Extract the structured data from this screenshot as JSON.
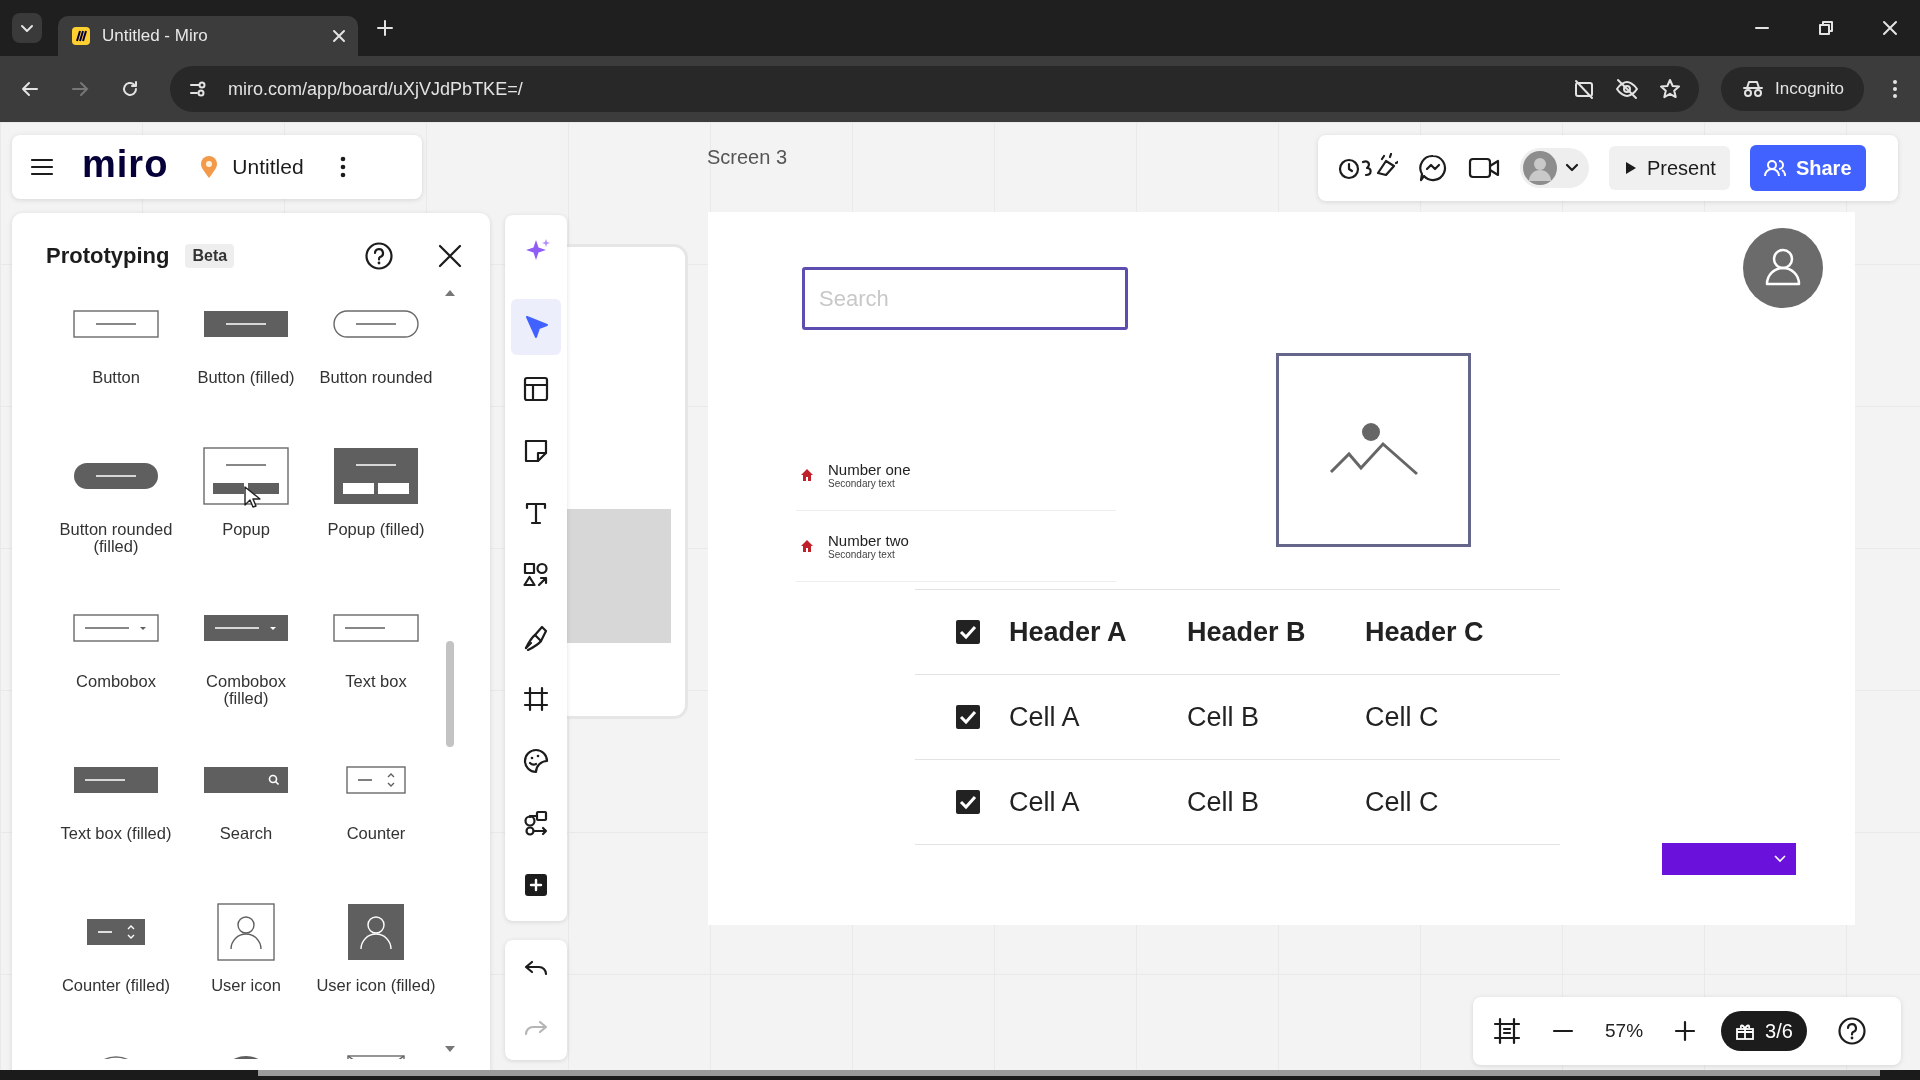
{
  "browser": {
    "tabs": [
      {
        "title": "Untitled - Miro",
        "selected": true
      }
    ],
    "url": "miro.com/app/board/uXjVJdPbTKE=/",
    "incognito_label": "Incognito"
  },
  "board_menu": {
    "logo": "miro",
    "board_name": "Untitled"
  },
  "frame_labels": [
    {
      "text": "Screen 3",
      "kind": "main"
    }
  ],
  "top_actions": {
    "present": "Present",
    "share": "Share"
  },
  "panel": {
    "title": "Prototyping",
    "badge": "Beta",
    "items": [
      {
        "label": "Button",
        "kind": "button"
      },
      {
        "label": "Button (filled)",
        "kind": "button-filled"
      },
      {
        "label": "Button rounded",
        "kind": "button-rounded"
      },
      {
        "label": "Button rounded (filled)",
        "kind": "button-rounded-filled"
      },
      {
        "label": "Popup",
        "kind": "popup"
      },
      {
        "label": "Popup (filled)",
        "kind": "popup-filled"
      },
      {
        "label": "Combobox",
        "kind": "combobox"
      },
      {
        "label": "Combobox (filled)",
        "kind": "combobox-filled"
      },
      {
        "label": "Text box",
        "kind": "textbox"
      },
      {
        "label": "Text box (filled)",
        "kind": "textbox-filled"
      },
      {
        "label": "Search",
        "kind": "search"
      },
      {
        "label": "Counter",
        "kind": "counter"
      },
      {
        "label": "Counter (filled)",
        "kind": "counter-filled"
      },
      {
        "label": "User icon",
        "kind": "user"
      },
      {
        "label": "User icon (filled)",
        "kind": "user-filled"
      },
      {
        "kind": "circle"
      },
      {
        "kind": "circle-filled"
      },
      {
        "kind": "image"
      }
    ]
  },
  "tools": [
    {
      "kind": "sparkle",
      "selected": false
    },
    {
      "kind": "pointer",
      "selected": true
    },
    {
      "kind": "template",
      "selected": false
    },
    {
      "kind": "sticky",
      "selected": false
    },
    {
      "kind": "text",
      "selected": false
    },
    {
      "kind": "shapes",
      "selected": false
    },
    {
      "kind": "pen",
      "selected": false
    },
    {
      "kind": "frame",
      "selected": false
    },
    {
      "kind": "sticker",
      "selected": false
    },
    {
      "kind": "diagram",
      "selected": false
    },
    {
      "kind": "add",
      "selected": false
    }
  ],
  "history": [
    {
      "kind": "undo",
      "disabled": false
    },
    {
      "kind": "redo",
      "disabled": true
    }
  ],
  "screen": {
    "search": {
      "placeholder": "Search"
    },
    "list": [
      {
        "title": "Number one",
        "subtitle": "Secondary text"
      },
      {
        "title": "Number two",
        "subtitle": "Secondary text"
      }
    ],
    "table": {
      "header": {
        "checked": true,
        "cells": [
          "Header A",
          "Header B",
          "Header C"
        ]
      },
      "rows": [
        {
          "checked": true,
          "cells": [
            "Cell A",
            "Cell B",
            "Cell C"
          ]
        },
        {
          "checked": true,
          "cells": [
            "Cell A",
            "Cell B",
            "Cell C"
          ]
        }
      ]
    }
  },
  "zoom": {
    "level_text": "57%",
    "gift_count": "3/6"
  }
}
